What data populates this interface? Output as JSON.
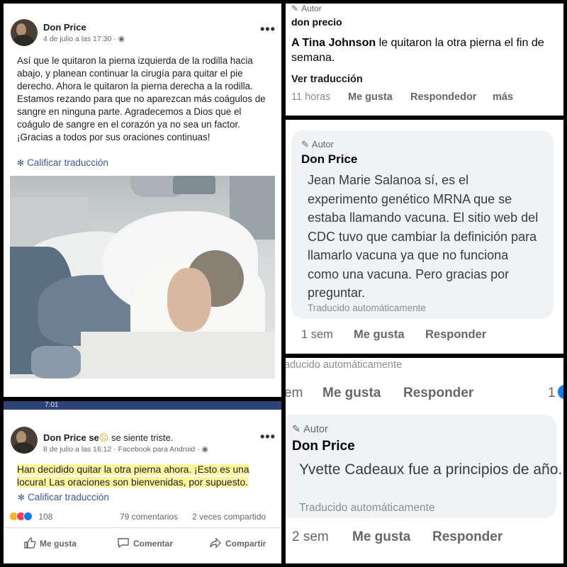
{
  "post1": {
    "author": "Don Price",
    "date": "4 de julio a las 17:30 · ",
    "privacy_icon": "globe-icon",
    "text": "Así que le quitaron la pierna izquierda de la rodilla hacia abajo, y planean continuar la cirugía para quitar el pie derecho. Ahora le quitaron la pierna derecha a la rodilla. Estamos rezando para que no aparezcan más coágulos de sangre en ninguna parte. Agradecemos a Dios que el coágulo de sangre en el corazón ya no sea un factor. ¡Gracias a todos por sus oraciones continuas!",
    "translate": "Calificar traducción"
  },
  "post2": {
    "statusbar_time": "7:01",
    "author": "Don Price",
    "feeling": "se",
    "feeling_after": " se siente triste.",
    "date": "8 de julio a las 16:12 · Facebook para Android · ",
    "text": "Han decidido quitar la otra pierna ahora. ¡Esto es una locura! Las oraciones son bienvenidas, por supuesto.",
    "translate": "Calificar traducción",
    "reaction_count": "108",
    "comments": "79 comentarios",
    "shares": "2 veces compartido",
    "like": "Me gusta",
    "comment": "Comentar",
    "share": "Compartir"
  },
  "comment1": {
    "author_tag": "Autor",
    "name": "don precio",
    "mention": "A Tina Johnson",
    "text": " le quitaron la otra pierna el fin de semana.",
    "see_translation": "Ver traducción",
    "time": "11 horas",
    "like": "Me gusta",
    "reply": "Respondedor",
    "more": "más"
  },
  "comment2": {
    "author_tag": "Autor",
    "name": "Don Price",
    "text": "Jean Marie Salanoa sí, es el experimento genético MRNA que se estaba llamando vacuna. El sitio web del CDC tuvo que cambiar la definición para llamarlo vacuna ya que no funciona como una vacuna. Pero gracias por preguntar.",
    "auto": "Traducido automáticamente",
    "time": "1 sem",
    "like": "Me gusta",
    "reply": "Responder"
  },
  "comment3": {
    "prev_auto": "aducido automáticamente",
    "prev_time": "em",
    "prev_like": "Me gusta",
    "prev_reply": "Responder",
    "prev_count": "1",
    "author_tag": "Autor",
    "name": "Don Price",
    "text": "Yvette Cadeaux fue a principios de año.",
    "auto": "Traducido automáticamente",
    "time": "2 sem",
    "like": "Me gusta",
    "reply": "Responder"
  },
  "colors": {
    "facebook_blue": "#385898",
    "highlight": "#fff59a",
    "like_blue": "#1877f2",
    "love_red": "#f33e58",
    "sad_yellow": "#f7b125"
  }
}
